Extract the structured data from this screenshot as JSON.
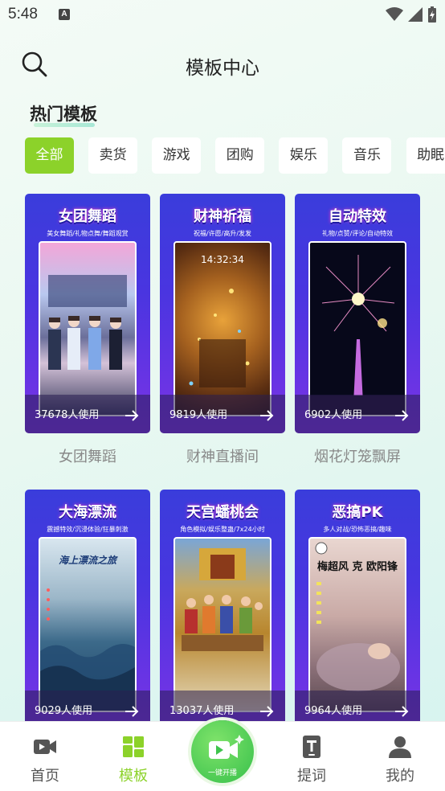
{
  "status": {
    "time": "5:48",
    "notification_icon": "A"
  },
  "header": {
    "title": "模板中心"
  },
  "section": {
    "title": "热门模板"
  },
  "categories": [
    "全部",
    "卖货",
    "游戏",
    "团购",
    "娱乐",
    "音乐",
    "助眠"
  ],
  "cards": [
    {
      "heading": "女团舞蹈",
      "subtitle": "美女舞蹈/礼物点舞/舞蹈观赏",
      "usage": "37678人使用",
      "label": "女团舞蹈"
    },
    {
      "heading": "财神祈福",
      "subtitle": "祝福/许愿/高升/发发",
      "usage": "9819人使用",
      "label": "财神直播间",
      "clock": "14:32:34"
    },
    {
      "heading": "自动特效",
      "subtitle": "礼物/点赞/评论/自动特效",
      "usage": "6902人使用",
      "label": "烟花灯笼飘屏"
    },
    {
      "heading": "大海漂流",
      "subtitle": "震撼特效/沉浸体验/狂暴刺激",
      "usage": "9029人使用",
      "label": "",
      "inner_text": "海上漂流之旅"
    },
    {
      "heading": "天宫蟠桃会",
      "subtitle": "角色模拟/娱乐整蛊/7x24小时",
      "usage": "13037人使用",
      "label": ""
    },
    {
      "heading": "恶搞PK",
      "subtitle": "多人对战/恐怖恶搞/趣味",
      "usage": "9964人使用",
      "label": "",
      "inner_text": "梅超风 克 欧阳锋"
    }
  ],
  "nav": {
    "home": "首页",
    "template": "模板",
    "live": "一键开播",
    "prompt": "提词",
    "mine": "我的"
  },
  "colors": {
    "accent": "#8cd22a",
    "card_purple": "#4935e0"
  }
}
